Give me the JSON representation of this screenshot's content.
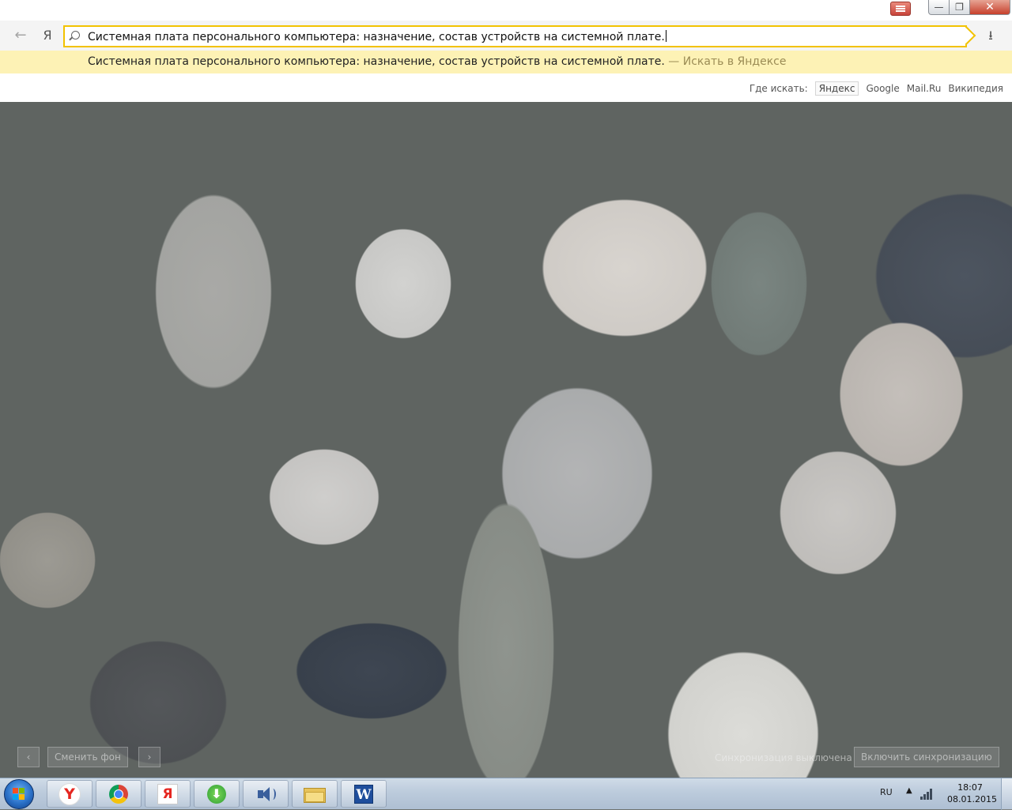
{
  "window": {
    "menu_icon": "menu-icon",
    "minimize_glyph": "—",
    "maximize_glyph": "❐",
    "close_glyph": "✕"
  },
  "navigation": {
    "back_icon": "back-arrow-icon",
    "back_glyph": "←",
    "logo_glyph": "Я",
    "download_icon": "download-icon",
    "download_glyph": "⭳"
  },
  "omnibox": {
    "query": "Системная плата персонального компьютера: назначение, состав устройств на системной плате."
  },
  "suggest": {
    "text": "Системная плата персонального компьютера: назначение, состав устройств на системной плате.",
    "action": " — Искать в Яндексе"
  },
  "search_engines": {
    "label": "Где искать:",
    "items": [
      "Яндекс",
      "Google",
      "Mail.Ru",
      "Википедия"
    ],
    "active": "Яндекс"
  },
  "wallpaper": {
    "prev_glyph": "‹",
    "change_bg_label": "Сменить фон",
    "next_glyph": "›",
    "sync_status": "Синхронизация выключена",
    "sync_enable_label": "Включить синхронизацию"
  },
  "taskbar": {
    "apps": [
      {
        "name": "Yandex Browser",
        "icon": "yandex-browser-icon",
        "glyph": "Y"
      },
      {
        "name": "Google Chrome",
        "icon": "chrome-icon"
      },
      {
        "name": "Yandex",
        "icon": "yandex-icon",
        "glyph": "Я"
      },
      {
        "name": "Download Manager",
        "icon": "download-manager-icon",
        "glyph": "⬇"
      },
      {
        "name": "Volume",
        "icon": "speaker-icon"
      },
      {
        "name": "Explorer",
        "icon": "folder-icon"
      },
      {
        "name": "Microsoft Word",
        "icon": "word-icon",
        "glyph": "W"
      }
    ],
    "tray": {
      "language": "RU",
      "arrow_glyph": "▲",
      "time": "18:07",
      "date": "08.01.2015"
    }
  },
  "colors": {
    "accent": "#f2c200",
    "suggest_bg": "#fdf2b5"
  }
}
